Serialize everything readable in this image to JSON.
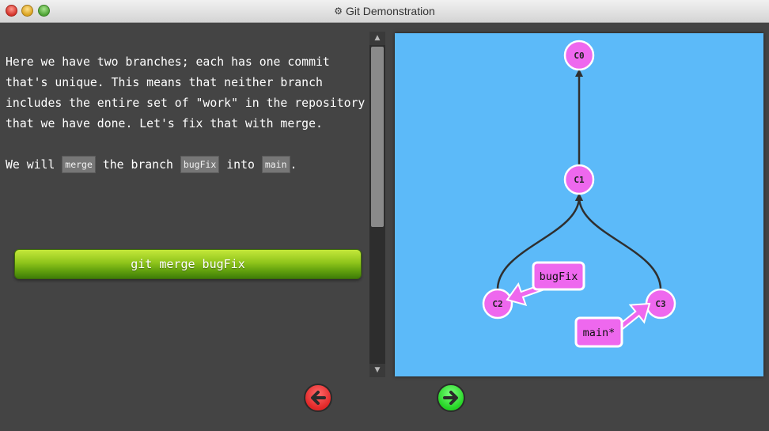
{
  "window": {
    "title": "Git Demonstration",
    "icon": "gear-icon"
  },
  "instructions": {
    "paragraph1": "Here we have two branches; each has one commit that's unique. This means that neither branch includes the entire set of \"work\" in the repository that we have done. Let's fix that with merge.",
    "p2_part1": "We will ",
    "p2_code1": "merge",
    "p2_part2": " the branch ",
    "p2_code2": "bugFix",
    "p2_part3": " into ",
    "p2_code3": "main",
    "p2_part4": "."
  },
  "command_button": {
    "label": "git merge bugFix"
  },
  "graph": {
    "colors": {
      "background": "#5cbaf9",
      "commit_fill": "#ee68ee",
      "branch_fill": "#ee68ee",
      "edge": "#2f2f2f"
    },
    "commits": [
      {
        "id": "C0"
      },
      {
        "id": "C1"
      },
      {
        "id": "C2"
      },
      {
        "id": "C3"
      }
    ],
    "edges": [
      {
        "from": "C1",
        "to": "C0"
      },
      {
        "from": "C2",
        "to": "C1"
      },
      {
        "from": "C3",
        "to": "C1"
      }
    ],
    "branches": [
      {
        "name": "bugFix",
        "target": "C2"
      },
      {
        "name": "main*",
        "target": "C3"
      }
    ]
  },
  "navigation": {
    "back_icon": "left-arrow-icon",
    "forward_icon": "right-arrow-icon",
    "back_color": "#e12727",
    "forward_color": "#24d424"
  }
}
